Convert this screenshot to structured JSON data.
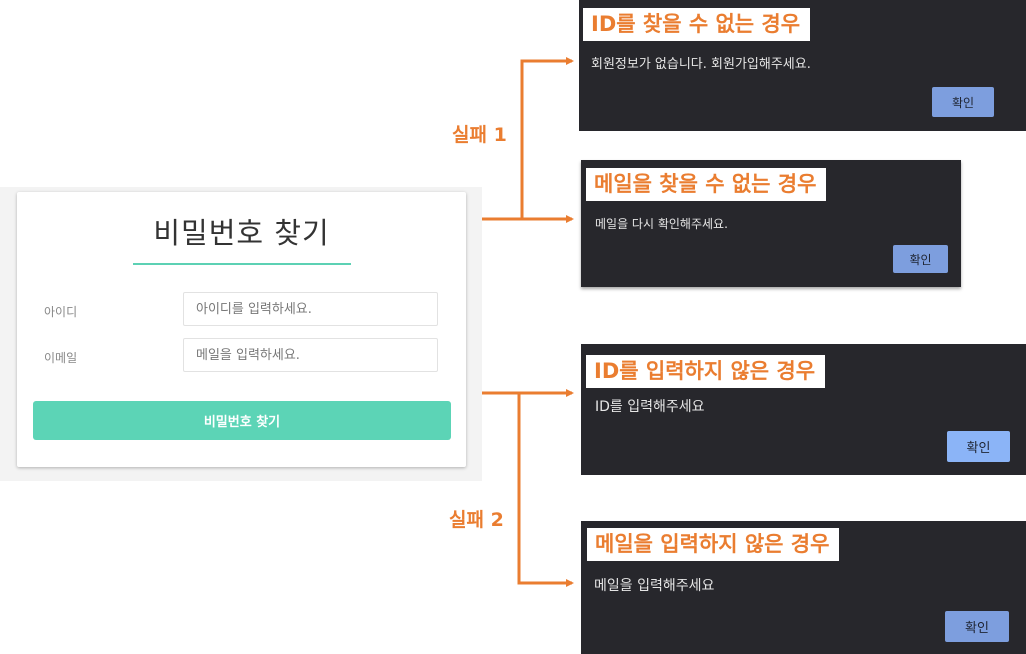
{
  "form": {
    "title": "비밀번호 찾기",
    "id_label": "아이디",
    "id_placeholder": "아이디를 입력하세요.",
    "email_label": "이메일",
    "email_placeholder": "메일을 입력하세요.",
    "submit_label": "비밀번호 찾기"
  },
  "flows": {
    "fail1_label": "실패 1",
    "fail2_label": "실패 2"
  },
  "dialogs": [
    {
      "heading": "ID를 찾을 수 없는 경우",
      "message": "회원정보가 없습니다. 회원가입해주세요.",
      "confirm_label": "확인"
    },
    {
      "heading": "메일을 찾을 수 없는 경우",
      "message": "메일을 다시 확인해주세요.",
      "confirm_label": "확인"
    },
    {
      "heading": "ID를 입력하지 않은 경우",
      "message": "ID를 입력해주세요",
      "confirm_label": "확인"
    },
    {
      "heading": "메일을 입력하지 않은 경우",
      "message": "메일을 입력해주세요",
      "confirm_label": "확인"
    }
  ],
  "colors": {
    "accent_green": "#5cd4b6",
    "annotation_orange": "#ea7d30",
    "dialog_bg": "#27272c",
    "confirm_blue": "#8bb4f7"
  }
}
